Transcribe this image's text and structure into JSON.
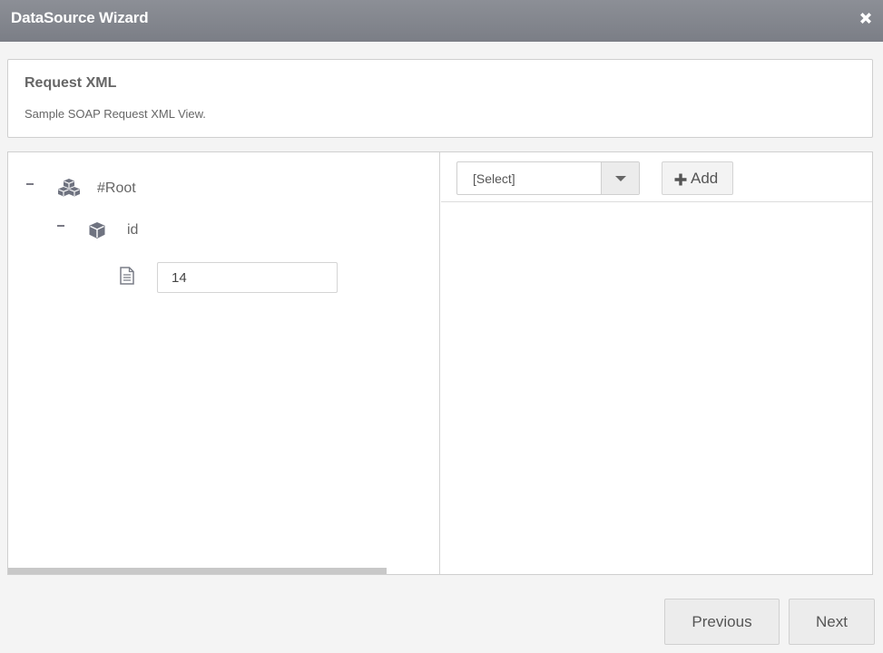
{
  "dialog": {
    "title": "DataSource Wizard",
    "close_icon": "close-icon"
  },
  "header": {
    "title": "Request XML",
    "description": "Sample SOAP Request XML View."
  },
  "tree": {
    "root": {
      "label": "#Root",
      "icon": "cubes-icon",
      "expanded": true
    },
    "child": {
      "label": "id",
      "icon": "cube-icon",
      "expanded": true
    },
    "value": {
      "icon": "document-icon",
      "value": "14"
    }
  },
  "right_panel": {
    "select_value": "[Select]",
    "add_label": "Add"
  },
  "footer": {
    "previous_label": "Previous",
    "next_label": "Next"
  },
  "colors": {
    "titlebar": "#8c8f96",
    "background": "#f4f4f4",
    "border": "#cfcfcf"
  }
}
